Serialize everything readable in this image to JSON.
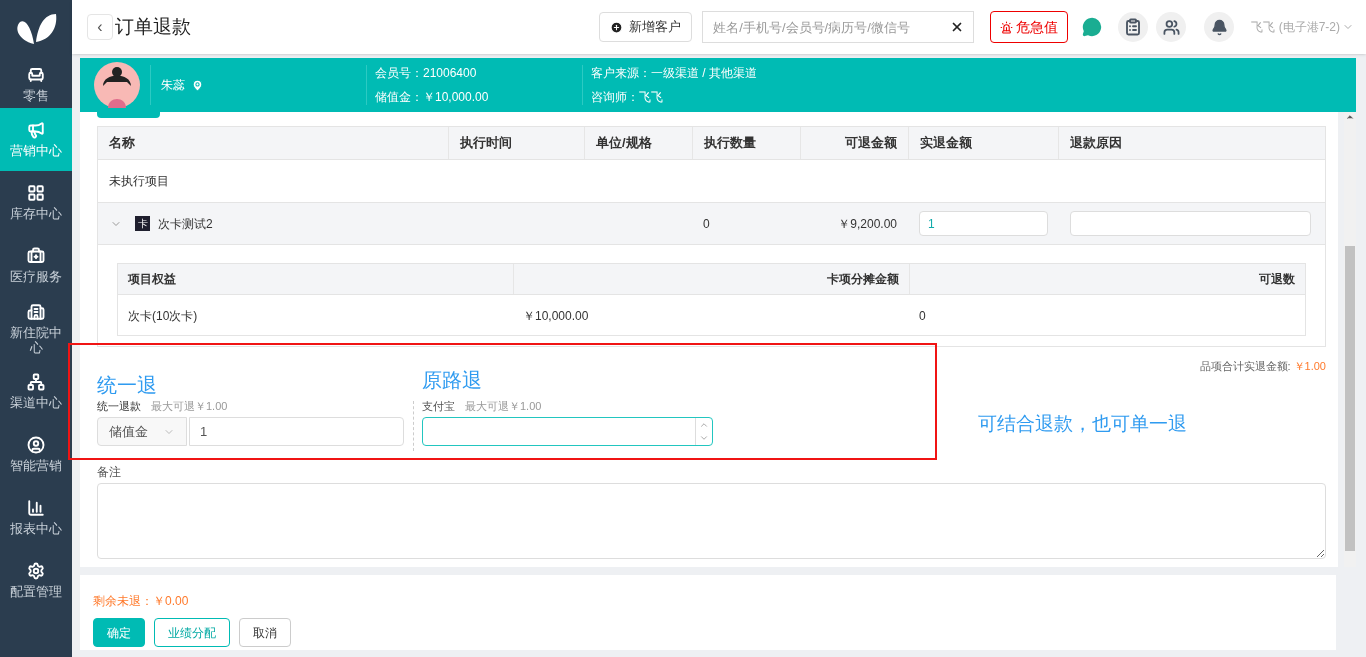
{
  "sidebar": {
    "items": [
      {
        "label": "零售",
        "selected": false
      },
      {
        "label": "营销中心",
        "selected": true
      },
      {
        "label": "库存中心",
        "selected": false
      },
      {
        "label": "医疗服务",
        "selected": false
      },
      {
        "label": "新住院中心",
        "selected": false
      },
      {
        "label": "渠道中心",
        "selected": false
      },
      {
        "label": "智能营销",
        "selected": false
      },
      {
        "label": "报表中心",
        "selected": false
      },
      {
        "label": "配置管理",
        "selected": false
      }
    ]
  },
  "header": {
    "title": "订单退款",
    "back": "‹",
    "new_customer_button": "新增客户",
    "search_placeholder": "姓名/手机号/会员号/病历号/微信号",
    "alert_button": "危急值",
    "user": "飞飞 (电子港7-2)"
  },
  "customer": {
    "name": "朱蕊",
    "member_no_label": "会员号：",
    "member_no": "21006400",
    "balance_label": "储值金：",
    "balance": "￥10,000.00",
    "source_label": "客户来源：",
    "source": "一级渠道 / 其他渠道",
    "consultant_label": "咨询师：",
    "consultant": "飞飞"
  },
  "table": {
    "columns": [
      "名称",
      "执行时间",
      "单位/规格",
      "执行数量",
      "可退金额",
      "实退金额",
      "退款原因"
    ],
    "group": "未执行项目",
    "item": {
      "name": "次卡测试2",
      "badge": "卡",
      "expanded": true,
      "quantity": "0",
      "refundable": "￥9,200.00",
      "refund_value": "1"
    },
    "subtable": {
      "columns": [
        "项目权益",
        "卡项分摊金额",
        "可退数"
      ],
      "rows": [
        [
          "次卡(10次卡)",
          "￥10,000.00",
          "0"
        ]
      ]
    }
  },
  "total": {
    "label": "品项合计实退金额:",
    "value": "￥1.00"
  },
  "refund": {
    "unified": {
      "annotation": "统一退",
      "label": "统一退款",
      "max": "最大可退￥1.00",
      "method": "储值金",
      "value": "1"
    },
    "original": {
      "annotation": "原路退",
      "label": "支付宝",
      "max": "最大可退￥1.00",
      "focused": true
    },
    "note": "可结合退款，也可单一退"
  },
  "remark": {
    "label": "备注"
  },
  "footer": {
    "remaining": "剩余未退：￥0.00",
    "buttons": [
      {
        "label": "确定",
        "kind": "primary"
      },
      {
        "label": "业绩分配",
        "kind": "outline"
      },
      {
        "label": "取消",
        "kind": "default"
      }
    ]
  }
}
